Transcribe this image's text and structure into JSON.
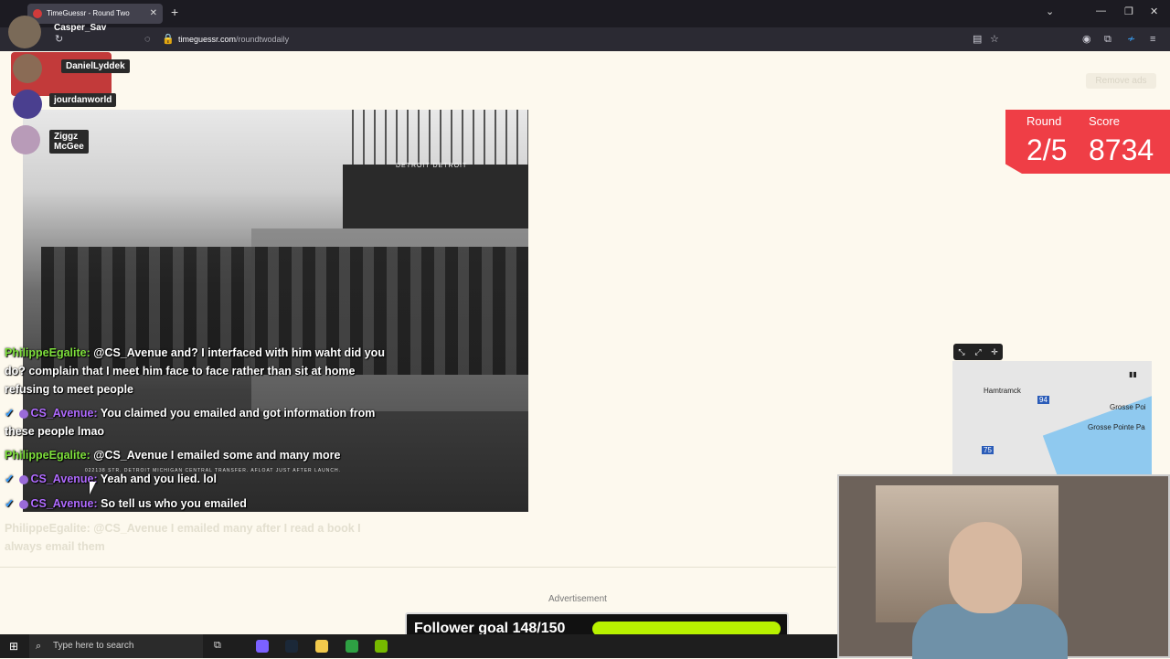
{
  "browser": {
    "tab_title": "TimeGuessr - Round Two",
    "url_domain": "timeguessr.com",
    "url_path": "/roundtwodaily"
  },
  "stream_overlay": {
    "streamer_name": "Casper_Sav",
    "users": [
      {
        "name": "DanielLyddek"
      },
      {
        "name": "jourdanworld"
      },
      {
        "name": "Ziggz McGee"
      }
    ]
  },
  "photo": {
    "caption_ship": "DETROIT DETROIT",
    "caption_bottom": "022138 STR. DETROIT MICHIGAN CENTRAL TRANSFER. AFLOAT JUST AFTER LAUNCH."
  },
  "chat": [
    {
      "user": "PhilippeEgalite:",
      "color": "green",
      "text": "@CS_Avenue and? I interfaced with him waht did you do? complain that I meet him face to face rather than sit at home refusing to meet people"
    },
    {
      "user": "CS_Avenue:",
      "color": "purple",
      "text": "You claimed you emailed and got information from these people lmao"
    },
    {
      "user": "PhilippeEgalite:",
      "color": "green",
      "text": "@CS_Avenue I emailed some and many more"
    },
    {
      "user": "CS_Avenue:",
      "color": "purple",
      "text": "Yeah and you lied. lol"
    },
    {
      "user": "CS_Avenue:",
      "color": "purple",
      "text": "So tell us who you emailed"
    },
    {
      "user": "PhilippeEgalite:",
      "color": "green",
      "text": "@CS_Avenue I emailed many after I read a book I always email them"
    }
  ],
  "game": {
    "remove_ads": "Remove ads",
    "round_label": "Round",
    "round_value": "2/5",
    "score_label": "Score",
    "score_value": "8734"
  },
  "map": {
    "labels": [
      "Hamtramck",
      "Grosse Poi",
      "Grosse Pointe Pa"
    ],
    "shields": [
      "94",
      "75"
    ]
  },
  "ad": {
    "label": "Advertisement"
  },
  "follower_goal": {
    "text": "Follower goal 148/150",
    "progress": 0.987
  },
  "taskbar": {
    "search_placeholder": "Type here to search"
  },
  "colors": {
    "score_red": "#ef3e46",
    "follower_bar": "#b8f200",
    "chat_green": "#7ee03c",
    "chat_purple": "#b06bff"
  }
}
